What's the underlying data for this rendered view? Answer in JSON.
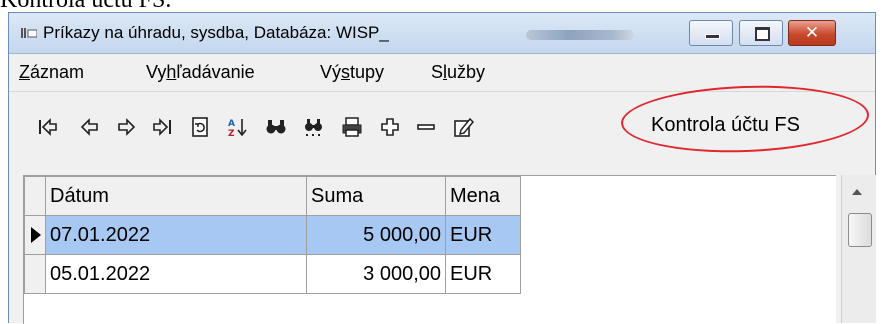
{
  "document": {
    "heading": "Kontrola účtu FS."
  },
  "window": {
    "title": "Príkazy na úhradu, sysdba,  Databáza: WISP_",
    "minimize_icon": "minimize-icon",
    "maximize_icon": "maximize-icon",
    "close_icon": "close-icon",
    "close_glyph": "✕"
  },
  "menu": {
    "items": [
      {
        "pre": "",
        "acc": "Z",
        "post": "áznam"
      },
      {
        "pre": "Vy",
        "acc": "h",
        "post": "ľadávanie"
      },
      {
        "pre": "Vý",
        "acc": "s",
        "post": "tupy"
      },
      {
        "pre": "S",
        "acc": "l",
        "post": "užby"
      }
    ]
  },
  "toolbar": {
    "icons": [
      {
        "name": "first-record-icon",
        "glyph": "|⇦"
      },
      {
        "name": "prev-record-icon",
        "glyph": "⇦"
      },
      {
        "name": "next-record-icon",
        "glyph": "⇨"
      },
      {
        "name": "last-record-icon",
        "glyph": "⇨|"
      },
      {
        "name": "refresh-icon",
        "glyph": "⟳"
      },
      {
        "name": "sort-az-icon",
        "glyph": "↓"
      },
      {
        "name": "find-icon",
        "glyph": "🔍"
      },
      {
        "name": "find-next-icon",
        "glyph": "🔍"
      },
      {
        "name": "print-icon",
        "glyph": "⎙"
      },
      {
        "name": "add-record-icon",
        "glyph": "✚"
      },
      {
        "name": "delete-record-icon",
        "glyph": "—"
      },
      {
        "name": "edit-record-icon",
        "glyph": "✎"
      }
    ],
    "action_label": "Kontrola účtu FS",
    "highlight_color": "#e0272e"
  },
  "grid": {
    "columns": [
      "Dátum",
      "Suma",
      "Mena"
    ],
    "rows": [
      {
        "date": "07.01.2022",
        "sum": "5 000,00",
        "currency": "EUR",
        "selected": true
      },
      {
        "date": "05.01.2022",
        "sum": "3 000,00",
        "currency": "EUR",
        "selected": false
      }
    ],
    "selection_color": "#a6c8f2"
  }
}
